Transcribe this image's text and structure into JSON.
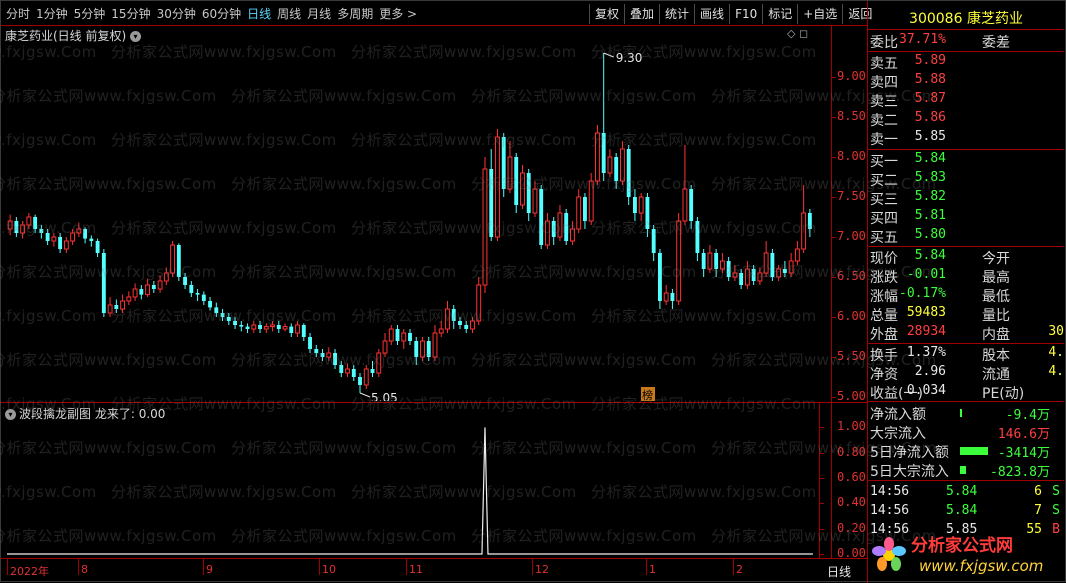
{
  "periods": [
    "分时",
    "1分钟",
    "5分钟",
    "15分钟",
    "30分钟",
    "60分钟",
    "日线",
    "周线",
    "月线",
    "多周期",
    "更多 >"
  ],
  "active_period": "日线",
  "tools": [
    "复权",
    "叠加",
    "统计",
    "画线",
    "F10",
    "标记",
    "+自选",
    "返回"
  ],
  "main_title": "康芝药业(日线 前复权)",
  "sub_title": "波段擒龙副图",
  "sub_indicator_label": "龙来了:",
  "sub_indicator_value": "0.00",
  "watermark": "分析家公式网www.fxjgsw.Com",
  "price_axis": [
    "9.00",
    "8.50",
    "8.00",
    "7.50",
    "7.00",
    "6.50",
    "6.00",
    "5.50",
    "5.00"
  ],
  "sub_axis": [
    "1.00",
    "0.80",
    "0.60",
    "0.40",
    "0.20",
    "0.00"
  ],
  "x_labels": [
    "2022年",
    "8",
    "9",
    "10",
    "11",
    "12",
    "1",
    "2"
  ],
  "x_footer": "日线",
  "high_mark": "9.30",
  "low_mark": "5.05",
  "badge": "榜",
  "colors": {
    "up": "#ff3232",
    "down": "#54ffff",
    "axis": "#a00000",
    "bg": "#000000"
  },
  "chart_data": {
    "type": "candlestick",
    "title": "康芝药业(日线 前复权)",
    "price_range": [
      4.95,
      9.45
    ],
    "high": 9.3,
    "low": 5.05,
    "candles": [
      [
        7.1,
        7.2,
        7.28,
        7.02
      ],
      [
        7.2,
        7.05,
        7.25,
        7.0
      ],
      [
        7.05,
        7.15,
        7.2,
        6.98
      ],
      [
        7.15,
        7.25,
        7.3,
        7.1
      ],
      [
        7.25,
        7.1,
        7.28,
        7.05
      ],
      [
        7.1,
        7.05,
        7.15,
        6.98
      ],
      [
        7.05,
        6.95,
        7.1,
        6.9
      ],
      [
        6.95,
        7.0,
        7.05,
        6.88
      ],
      [
        7.0,
        6.85,
        7.05,
        6.8
      ],
      [
        6.85,
        6.95,
        7.0,
        6.8
      ],
      [
        6.95,
        7.05,
        7.1,
        6.9
      ],
      [
        7.05,
        7.1,
        7.18,
        7.0
      ],
      [
        7.1,
        6.98,
        7.12,
        6.92
      ],
      [
        6.98,
        6.95,
        7.02,
        6.88
      ],
      [
        6.95,
        6.8,
        6.98,
        6.75
      ],
      [
        6.8,
        6.05,
        6.85,
        6.0
      ],
      [
        6.05,
        6.15,
        6.25,
        6.0
      ],
      [
        6.15,
        6.1,
        6.22,
        6.05
      ],
      [
        6.1,
        6.2,
        6.28,
        6.05
      ],
      [
        6.2,
        6.25,
        6.32,
        6.15
      ],
      [
        6.25,
        6.35,
        6.42,
        6.2
      ],
      [
        6.35,
        6.28,
        6.4,
        6.22
      ],
      [
        6.28,
        6.4,
        6.48,
        6.25
      ],
      [
        6.4,
        6.35,
        6.45,
        6.3
      ],
      [
        6.35,
        6.45,
        6.52,
        6.3
      ],
      [
        6.45,
        6.55,
        6.62,
        6.4
      ],
      [
        6.55,
        6.9,
        6.95,
        6.5
      ],
      [
        6.9,
        6.5,
        6.92,
        6.45
      ],
      [
        6.5,
        6.4,
        6.55,
        6.35
      ],
      [
        6.4,
        6.3,
        6.45,
        6.25
      ],
      [
        6.3,
        6.28,
        6.35,
        6.2
      ],
      [
        6.28,
        6.2,
        6.32,
        6.15
      ],
      [
        6.2,
        6.12,
        6.25,
        6.08
      ],
      [
        6.12,
        6.05,
        6.18,
        6.0
      ],
      [
        6.05,
        6.0,
        6.1,
        5.95
      ],
      [
        6.0,
        5.95,
        6.05,
        5.9
      ],
      [
        5.95,
        5.9,
        6.0,
        5.85
      ],
      [
        5.9,
        5.88,
        5.95,
        5.82
      ],
      [
        5.88,
        5.85,
        5.92,
        5.8
      ],
      [
        5.85,
        5.9,
        5.95,
        5.8
      ],
      [
        5.9,
        5.85,
        5.95,
        5.8
      ],
      [
        5.85,
        5.88,
        5.92,
        5.8
      ],
      [
        5.88,
        5.9,
        5.95,
        5.82
      ],
      [
        5.9,
        5.85,
        5.95,
        5.8
      ],
      [
        5.85,
        5.88,
        5.92,
        5.82
      ],
      [
        5.88,
        5.8,
        5.92,
        5.75
      ],
      [
        5.8,
        5.9,
        5.95,
        5.75
      ],
      [
        5.9,
        5.75,
        5.92,
        5.7
      ],
      [
        5.75,
        5.6,
        5.8,
        5.55
      ],
      [
        5.6,
        5.55,
        5.65,
        5.5
      ],
      [
        5.55,
        5.5,
        5.6,
        5.45
      ],
      [
        5.5,
        5.55,
        5.62,
        5.45
      ],
      [
        5.55,
        5.4,
        5.6,
        5.35
      ],
      [
        5.4,
        5.3,
        5.45,
        5.25
      ],
      [
        5.3,
        5.35,
        5.42,
        5.25
      ],
      [
        5.35,
        5.25,
        5.4,
        5.2
      ],
      [
        5.25,
        5.15,
        5.3,
        5.05
      ],
      [
        5.15,
        5.35,
        5.4,
        5.1
      ],
      [
        5.35,
        5.3,
        5.45,
        5.25
      ],
      [
        5.3,
        5.55,
        5.6,
        5.25
      ],
      [
        5.55,
        5.7,
        5.8,
        5.5
      ],
      [
        5.7,
        5.85,
        5.9,
        5.65
      ],
      [
        5.85,
        5.7,
        5.9,
        5.65
      ],
      [
        5.7,
        5.8,
        5.85,
        5.6
      ],
      [
        5.8,
        5.7,
        5.85,
        5.65
      ],
      [
        5.7,
        5.5,
        5.75,
        5.4
      ],
      [
        5.5,
        5.7,
        5.75,
        5.45
      ],
      [
        5.7,
        5.5,
        5.75,
        5.45
      ],
      [
        5.5,
        5.8,
        5.9,
        5.45
      ],
      [
        5.8,
        5.85,
        5.95,
        5.75
      ],
      [
        5.85,
        6.1,
        6.2,
        5.8
      ],
      [
        6.1,
        5.95,
        6.15,
        5.85
      ],
      [
        5.95,
        5.9,
        6.0,
        5.85
      ],
      [
        5.9,
        5.85,
        5.95,
        5.8
      ],
      [
        5.85,
        5.95,
        6.0,
        5.8
      ],
      [
        5.95,
        6.4,
        6.5,
        5.9
      ],
      [
        6.4,
        7.85,
        8.0,
        6.3
      ],
      [
        7.85,
        7.0,
        8.1,
        6.95
      ],
      [
        7.0,
        8.25,
        8.35,
        6.95
      ],
      [
        8.25,
        7.6,
        8.3,
        7.5
      ],
      [
        7.6,
        8.0,
        8.2,
        7.55
      ],
      [
        8.0,
        7.4,
        8.05,
        7.3
      ],
      [
        7.4,
        7.8,
        7.9,
        7.35
      ],
      [
        7.8,
        7.3,
        7.85,
        7.2
      ],
      [
        7.3,
        7.6,
        7.7,
        7.25
      ],
      [
        7.6,
        6.9,
        7.65,
        6.85
      ],
      [
        6.9,
        7.2,
        7.3,
        6.85
      ],
      [
        7.2,
        7.0,
        7.25,
        6.9
      ],
      [
        7.0,
        7.3,
        7.4,
        6.95
      ],
      [
        7.3,
        6.95,
        7.35,
        6.9
      ],
      [
        6.95,
        7.1,
        7.2,
        6.9
      ],
      [
        7.1,
        7.5,
        7.6,
        7.05
      ],
      [
        7.5,
        7.2,
        7.55,
        7.1
      ],
      [
        7.2,
        7.7,
        7.8,
        7.15
      ],
      [
        7.7,
        8.3,
        8.4,
        7.65
      ],
      [
        8.3,
        7.8,
        9.3,
        7.7
      ],
      [
        7.8,
        8.0,
        8.1,
        7.75
      ],
      [
        8.0,
        7.7,
        8.05,
        7.6
      ],
      [
        7.7,
        8.1,
        8.2,
        7.65
      ],
      [
        8.1,
        7.5,
        8.15,
        7.4
      ],
      [
        7.5,
        7.3,
        7.6,
        7.2
      ],
      [
        7.3,
        7.5,
        7.55,
        7.2
      ],
      [
        7.5,
        7.1,
        7.55,
        7.0
      ],
      [
        7.1,
        6.8,
        7.15,
        6.7
      ],
      [
        6.8,
        6.2,
        6.85,
        6.1
      ],
      [
        6.2,
        6.3,
        6.4,
        6.15
      ],
      [
        6.3,
        6.2,
        6.35,
        6.1
      ],
      [
        6.2,
        7.2,
        7.3,
        6.15
      ],
      [
        7.2,
        7.6,
        8.15,
        7.15
      ],
      [
        7.6,
        7.2,
        7.65,
        7.1
      ],
      [
        7.2,
        6.8,
        7.25,
        6.7
      ],
      [
        6.8,
        6.6,
        6.85,
        6.5
      ],
      [
        6.6,
        6.8,
        6.9,
        6.55
      ],
      [
        6.8,
        6.6,
        6.85,
        6.5
      ],
      [
        6.6,
        6.7,
        6.8,
        6.55
      ],
      [
        6.7,
        6.5,
        6.75,
        6.45
      ],
      [
        6.5,
        6.55,
        6.65,
        6.45
      ],
      [
        6.55,
        6.4,
        6.6,
        6.35
      ],
      [
        6.4,
        6.6,
        6.7,
        6.35
      ],
      [
        6.6,
        6.45,
        6.65,
        6.4
      ],
      [
        6.45,
        6.55,
        6.62,
        6.4
      ],
      [
        6.55,
        6.8,
        6.95,
        6.5
      ],
      [
        6.8,
        6.5,
        6.85,
        6.45
      ],
      [
        6.5,
        6.6,
        6.65,
        6.45
      ],
      [
        6.6,
        6.55,
        6.7,
        6.5
      ],
      [
        6.55,
        6.7,
        6.8,
        6.5
      ],
      [
        6.7,
        6.85,
        6.95,
        6.65
      ],
      [
        6.85,
        7.3,
        7.65,
        6.8
      ],
      [
        7.3,
        7.1,
        7.35,
        7.0
      ]
    ],
    "sub_series": {
      "name": "龙来了",
      "range": [
        0,
        1.05
      ],
      "spike_index": 76,
      "spike_value": 1.0
    }
  },
  "quote": {
    "code_name": "300086 康芝药业",
    "weibi_label": "委比",
    "weibi_val": "37.71%",
    "weicha_label": "委差",
    "asks": [
      {
        "l": "卖五",
        "v": "5.89"
      },
      {
        "l": "卖四",
        "v": "5.88"
      },
      {
        "l": "卖三",
        "v": "5.87"
      },
      {
        "l": "卖二",
        "v": "5.86"
      },
      {
        "l": "卖一",
        "v": "5.85"
      }
    ],
    "bids": [
      {
        "l": "买一",
        "v": "5.84"
      },
      {
        "l": "买二",
        "v": "5.83"
      },
      {
        "l": "买三",
        "v": "5.82"
      },
      {
        "l": "买四",
        "v": "5.81"
      },
      {
        "l": "买五",
        "v": "5.80"
      }
    ],
    "stats": [
      {
        "l": "现价",
        "v": "5.84",
        "c": "green",
        "l2": "今开"
      },
      {
        "l": "涨跌",
        "v": "-0.01",
        "c": "green",
        "l2": "最高"
      },
      {
        "l": "涨幅",
        "v": "-0.17%",
        "c": "green",
        "l2": "最低"
      },
      {
        "l": "总量",
        "v": "59483",
        "c": "yellow",
        "l2": "量比"
      },
      {
        "l": "外盘",
        "v": "28934",
        "c": "red",
        "l2": "内盘",
        "v2": "30"
      }
    ],
    "stats2": [
      {
        "l": "换手",
        "v": "1.37%",
        "l2": "股本",
        "v2": "4."
      },
      {
        "l": "净资",
        "v": "2.96",
        "l2": "流通",
        "v2": "4."
      },
      {
        "l": "收益(一)",
        "v": "0.034",
        "l2": "PE(动)",
        "v2": ""
      }
    ],
    "flows": [
      {
        "l": "净流入额",
        "v": "-9.4万",
        "c": "green"
      },
      {
        "l": "大宗流入",
        "v": "146.6万",
        "c": "red"
      },
      {
        "l": "5日净流入额",
        "v": "-3414万",
        "c": "green"
      },
      {
        "l": "5日大宗流入",
        "v": "-823.8万",
        "c": "green"
      }
    ],
    "ticks": [
      {
        "t": "14:56",
        "p": "5.84",
        "q": "6",
        "s": "S"
      },
      {
        "t": "14:56",
        "p": "5.84",
        "q": "7",
        "s": "S"
      },
      {
        "t": "14:56",
        "p": "5.85",
        "q": "55",
        "s": "B"
      }
    ]
  },
  "logo": {
    "text": "分析家公式网",
    "url": "www.fxjgsw.com"
  }
}
